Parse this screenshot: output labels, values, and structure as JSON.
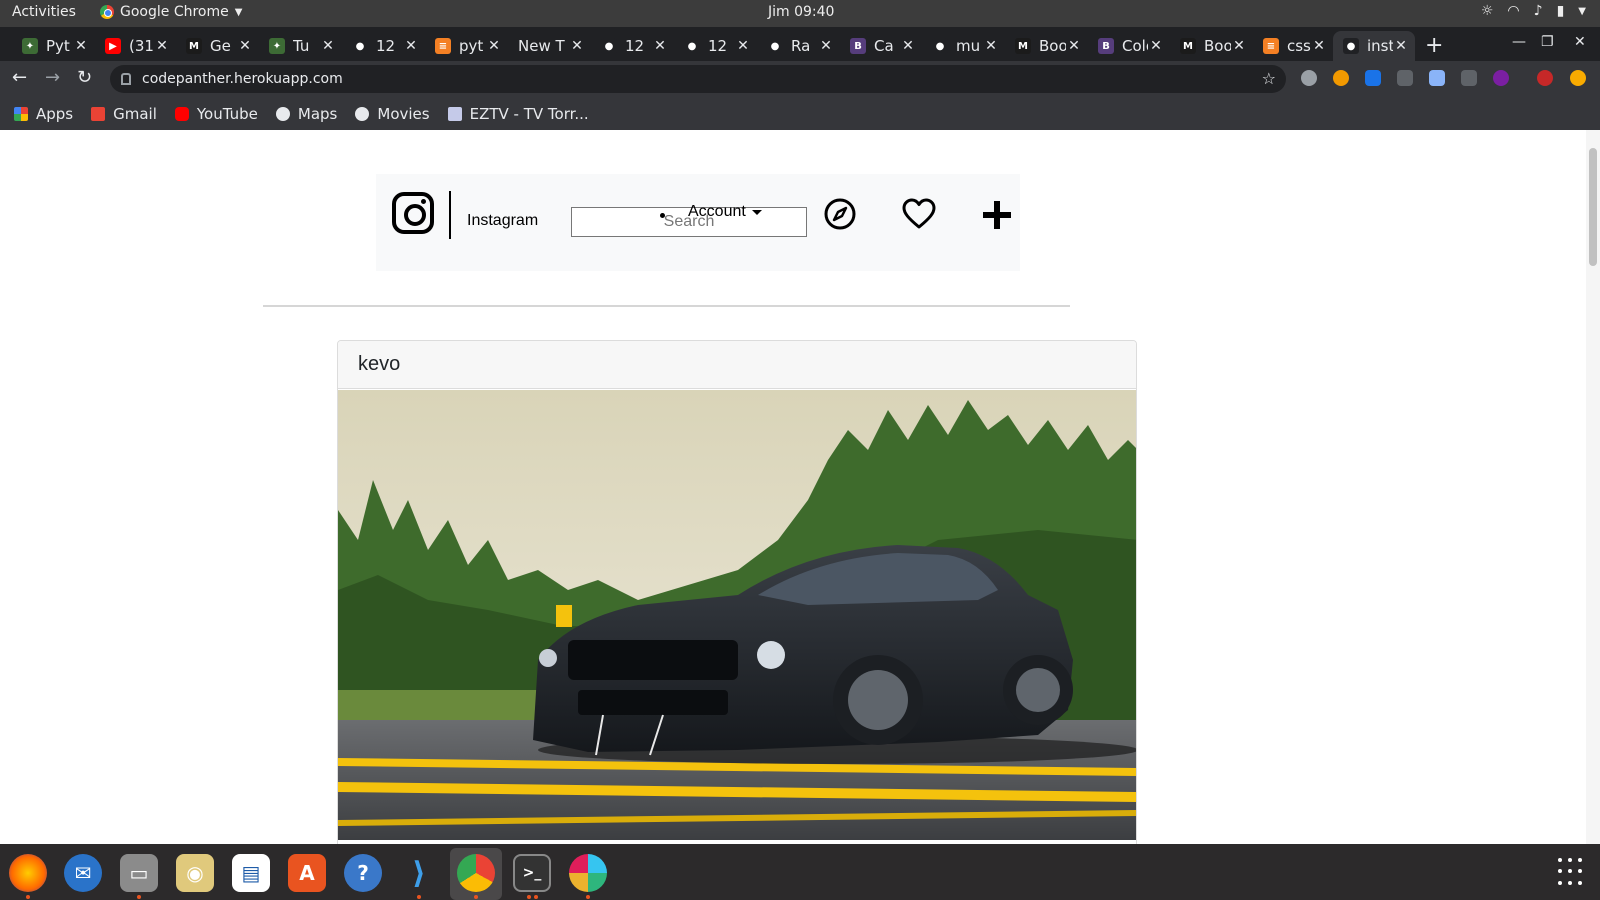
{
  "system_bar": {
    "activities": "Activities",
    "app_name": "Google Chrome",
    "clock": "Jim 09:40"
  },
  "tabs": [
    {
      "label": "Pyt",
      "icon": "palm-icon",
      "color": "#3d6b35"
    },
    {
      "label": "(31",
      "icon": "youtube-icon",
      "color": "#ff0000"
    },
    {
      "label": "Ge",
      "icon": "mdn-icon",
      "color": "#1b1b1b"
    },
    {
      "label": "Tu",
      "icon": "palm-icon",
      "color": "#3d6b35"
    },
    {
      "label": "12",
      "icon": "globe-icon",
      "color": "#202124"
    },
    {
      "label": "pyt",
      "icon": "stackoverflow-icon",
      "color": "#f48024"
    },
    {
      "label": "New T",
      "icon": "",
      "color": ""
    },
    {
      "label": "12",
      "icon": "globe-icon",
      "color": "#202124"
    },
    {
      "label": "12",
      "icon": "globe-icon",
      "color": "#202124"
    },
    {
      "label": "Ra",
      "icon": "github-icon",
      "color": "#202124"
    },
    {
      "label": "Ca",
      "icon": "bootstrap-icon",
      "color": "#563d7c"
    },
    {
      "label": "mu",
      "icon": "github-icon",
      "color": "#202124"
    },
    {
      "label": "Boots",
      "icon": "mdn-icon",
      "color": "#1b1b1b"
    },
    {
      "label": "Colors",
      "icon": "bootstrap-icon",
      "color": "#563d7c"
    },
    {
      "label": "Boots",
      "icon": "mdn-icon",
      "color": "#1b1b1b"
    },
    {
      "label": "css - B",
      "icon": "stackoverflow-icon",
      "color": "#f48024"
    },
    {
      "label": "inst",
      "icon": "globe-icon",
      "color": "#202124",
      "active": true
    }
  ],
  "toolbar": {
    "url": "codepanther.herokuapp.com"
  },
  "bookmarks": [
    {
      "label": "Apps",
      "icon": "apps-grid-icon"
    },
    {
      "label": "Gmail",
      "icon": "gmail-icon"
    },
    {
      "label": "YouTube",
      "icon": "youtube-icon"
    },
    {
      "label": "Maps",
      "icon": "globe-icon"
    },
    {
      "label": "Movies",
      "icon": "globe-icon"
    },
    {
      "label": "EZTV - TV Torr...",
      "icon": "eztv-icon"
    }
  ],
  "site": {
    "brand": "Instagram",
    "search_placeholder": "Search",
    "account_label": "Account",
    "post": {
      "username": "kevo",
      "image": "black-mustang-photo"
    }
  },
  "colors": {
    "chrome_dark": "#202124",
    "chrome_toolbar": "#35363a",
    "ubuntu_accent": "#e95420",
    "nav_panel_bg": "#f8f9fa"
  }
}
